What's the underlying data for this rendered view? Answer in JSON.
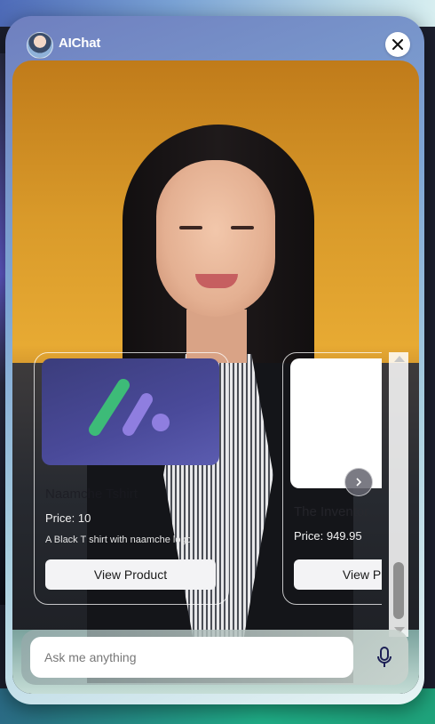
{
  "header": {
    "title": "AIChat"
  },
  "products": [
    {
      "name": "Naamche Tshirt",
      "price": "Price: 10",
      "description": "A Black T shirt with naamche logo",
      "button_label": "View Product"
    },
    {
      "name": "The Inventor",
      "price": "Price: 949.95",
      "button_label": "View Product"
    }
  ],
  "input": {
    "placeholder": "Ask me anything",
    "value": ""
  },
  "colors": {
    "accent_purple": "#5b5cb0",
    "logo_green": "#3dbb78",
    "logo_violet": "#8f7ee0"
  },
  "icons": {
    "close": "close-icon",
    "mic": "microphone-icon",
    "next": "chevron-right-icon"
  }
}
